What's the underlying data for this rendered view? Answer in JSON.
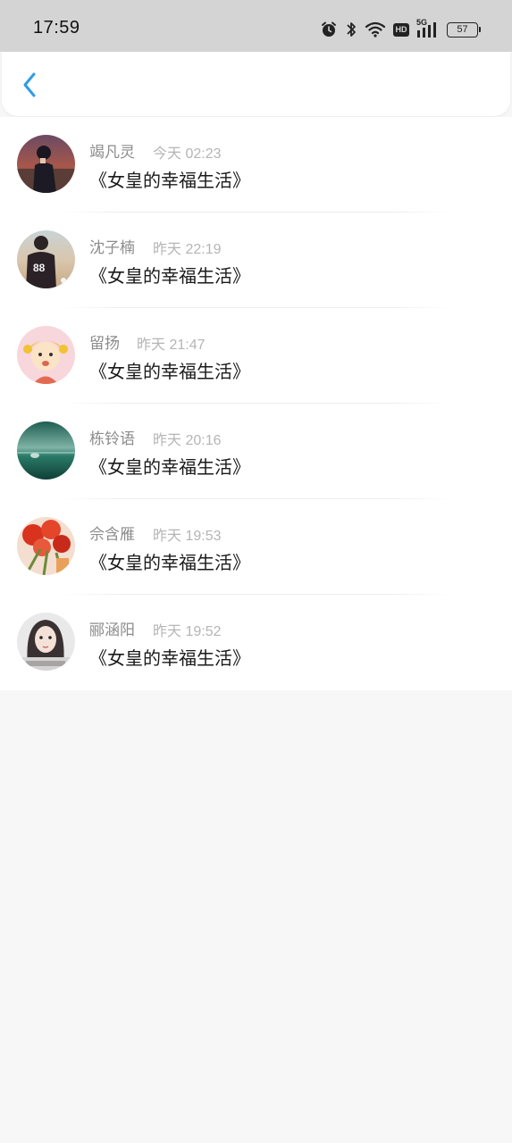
{
  "status_bar": {
    "time": "17:59",
    "icons": [
      "alarm-icon",
      "bluetooth-icon",
      "wifi-icon",
      "hd-icon",
      "signal-5g-icon",
      "battery-icon"
    ],
    "hd_label": "HD",
    "network_label": "5G",
    "battery_level": "57"
  },
  "nav": {
    "back_icon": "chevron-left-icon",
    "accent_color": "#2f9be8"
  },
  "messages": [
    {
      "name": "竭凡灵",
      "time": "今天 02:23",
      "text": "《女皇的幸福生活》"
    },
    {
      "name": "沈子楠",
      "time": "昨天 22:19",
      "text": "《女皇的幸福生活》"
    },
    {
      "name": "留扬",
      "time": "昨天 21:47",
      "text": "《女皇的幸福生活》"
    },
    {
      "name": "栋铃语",
      "time": "昨天 20:16",
      "text": "《女皇的幸福生活》"
    },
    {
      "name": "佘含雁",
      "time": "昨天 19:53",
      "text": "《女皇的幸福生活》"
    },
    {
      "name": "郦涵阳",
      "time": "昨天 19:52",
      "text": "《女皇的幸福生活》"
    }
  ]
}
